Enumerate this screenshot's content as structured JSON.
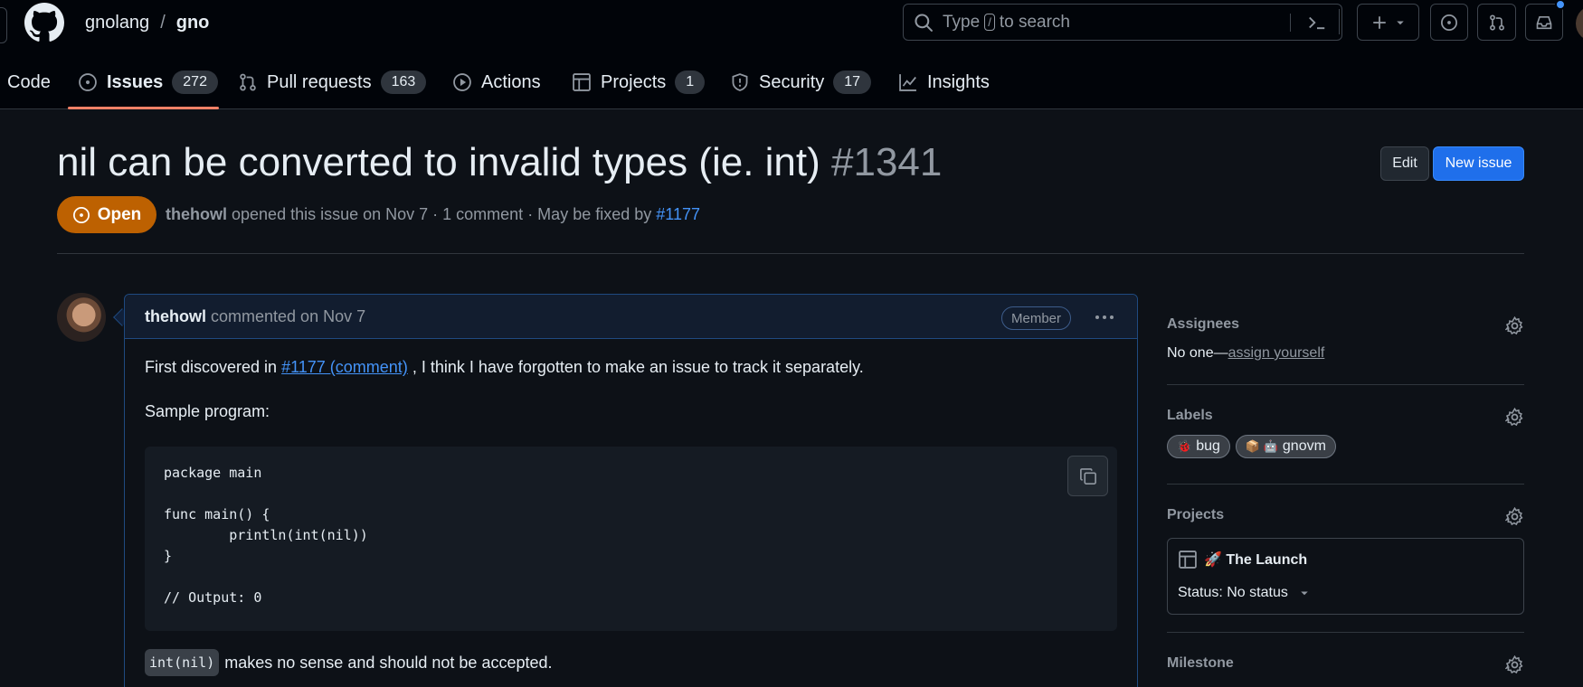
{
  "header": {
    "owner": "gnolang",
    "separator": "/",
    "repo": "gno",
    "search": {
      "prefix": "Type",
      "key": "/",
      "suffix": "to search"
    }
  },
  "tabs": [
    {
      "label": "Code",
      "counter": null,
      "icon": "code-icon"
    },
    {
      "label": "Issues",
      "counter": "272",
      "icon": "issue-opened-icon",
      "selected": true
    },
    {
      "label": "Pull requests",
      "counter": "163",
      "icon": "git-pull-request-icon"
    },
    {
      "label": "Actions",
      "counter": null,
      "icon": "play-icon"
    },
    {
      "label": "Projects",
      "counter": "1",
      "icon": "table-icon"
    },
    {
      "label": "Security",
      "counter": "17",
      "icon": "shield-icon"
    },
    {
      "label": "Insights",
      "counter": null,
      "icon": "graph-icon"
    }
  ],
  "issue": {
    "title": "nil can be converted to invalid types (ie. int)",
    "number": "#1341",
    "state": "Open",
    "author": "thehowl",
    "meta_text": "opened this issue on Nov 7 · 1 comment · May be fixed by",
    "fixed_by": "#1177",
    "edit_label": "Edit",
    "new_issue_label": "New issue"
  },
  "comment": {
    "author": "thehowl",
    "action": "commented on Nov 7",
    "badge": "Member",
    "p1_before": "First discovered in",
    "p1_link": "#1177 (comment)",
    "p1_after": ", I think I have forgotten to make an issue to track it separately.",
    "p2": "Sample program:",
    "code": "package main\n\nfunc main() {\n        println(int(nil))\n}\n\n// Output: 0",
    "p3_code": "int(nil)",
    "p3_text": "makes no sense and should not be accepted."
  },
  "sidebar": {
    "assignees": {
      "heading": "Assignees",
      "none": "No one—",
      "assign_link": "assign yourself"
    },
    "labels": {
      "heading": "Labels",
      "items": [
        {
          "text": "bug",
          "emoji": "🐞",
          "color": "#d73a4a"
        },
        {
          "text": "gnovm",
          "emoji": "📦 🤖",
          "color": "#a2eeef"
        }
      ]
    },
    "projects": {
      "heading": "Projects",
      "name": "🚀 The Launch",
      "status": "Status: No status"
    },
    "milestone": {
      "heading": "Milestone"
    }
  },
  "colors": {
    "accent": "#1f6feb",
    "open_state": "#bd6101",
    "tab_underline": "#f78166",
    "link": "#4493f8"
  }
}
